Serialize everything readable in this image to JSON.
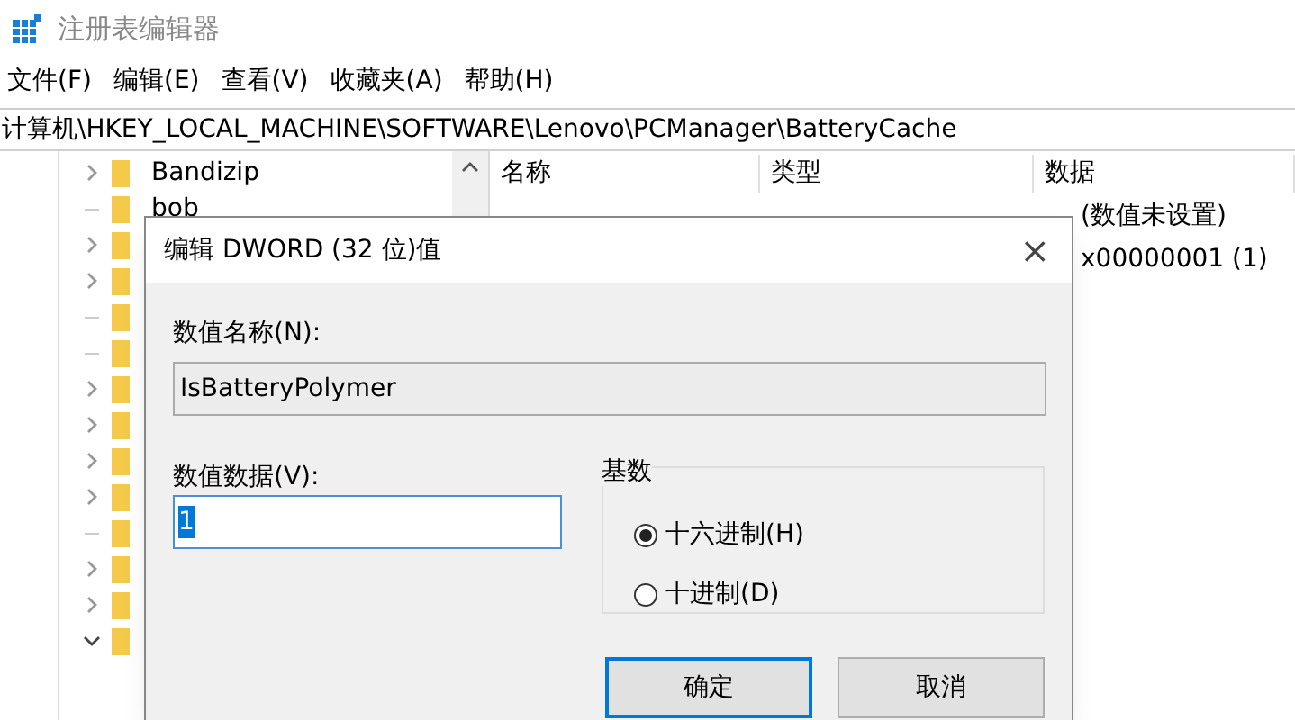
{
  "window": {
    "title": "注册表编辑器"
  },
  "menu": [
    "文件(F)",
    "编辑(E)",
    "查看(V)",
    "收藏夹(A)",
    "帮助(H)"
  ],
  "address": "计算机\\HKEY_LOCAL_MACHINE\\SOFTWARE\\Lenovo\\PCManager\\BatteryCache",
  "tree": [
    {
      "label": "Bandizip",
      "has_children": true,
      "expanded": false
    },
    {
      "label": "bob",
      "has_children": false
    },
    {
      "has_children": true,
      "expanded": false
    },
    {
      "has_children": true,
      "expanded": false
    },
    {
      "has_children": false
    },
    {
      "has_children": false
    },
    {
      "has_children": true,
      "expanded": false
    },
    {
      "has_children": true,
      "expanded": false
    },
    {
      "has_children": true,
      "expanded": false
    },
    {
      "has_children": true,
      "expanded": false
    },
    {
      "has_children": false
    },
    {
      "has_children": true,
      "expanded": false
    },
    {
      "has_children": true,
      "expanded": false
    },
    {
      "has_children": true,
      "expanded": true
    }
  ],
  "table": {
    "columns": [
      "名称",
      "类型",
      "数据"
    ],
    "rows": [
      {
        "data": "(数值未设置)"
      },
      {
        "data": "x00000001 (1)"
      }
    ]
  },
  "dialog": {
    "title": "编辑 DWORD (32 位)值",
    "close": "×",
    "name_label": "数值名称(N):",
    "name_value": "IsBatteryPolymer",
    "data_label": "数值数据(V):",
    "data_value": "1",
    "base_label": "基数",
    "bases": [
      {
        "label": "十六进制(H)",
        "selected": true
      },
      {
        "label": "十进制(D)",
        "selected": false
      }
    ],
    "buttons": [
      {
        "label": "确定",
        "default": true
      },
      {
        "label": "取消",
        "default": false
      }
    ]
  }
}
